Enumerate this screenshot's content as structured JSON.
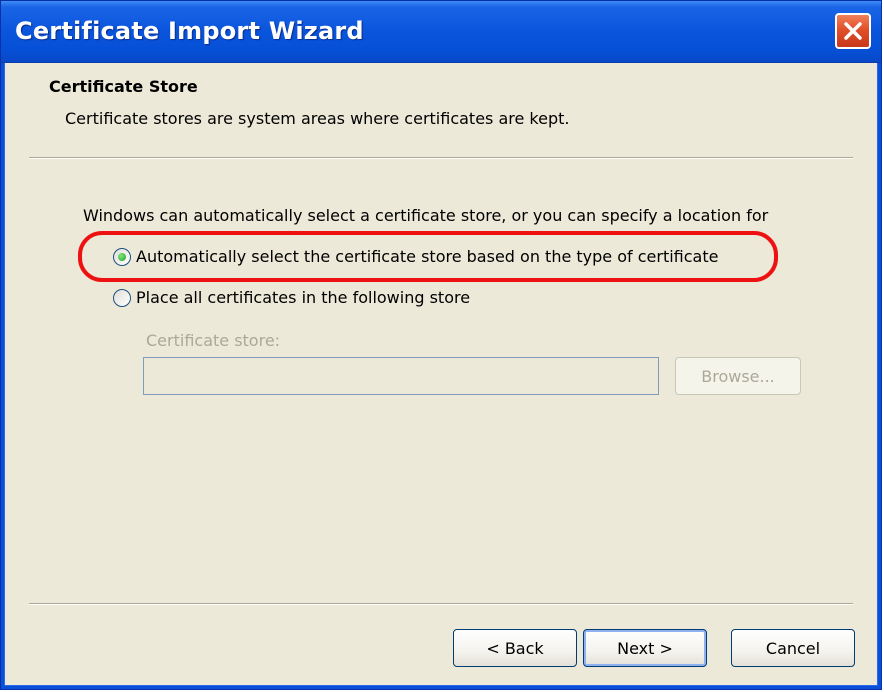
{
  "window": {
    "title": "Certificate Import Wizard",
    "close_icon": "close-icon"
  },
  "header": {
    "title": "Certificate Store",
    "subtitle": "Certificate stores are system areas where certificates are kept."
  },
  "body": {
    "intro": "Windows can automatically select a certificate store, or you can specify a location for",
    "options": [
      {
        "label": "Automatically select the certificate store based on the type of certificate",
        "checked": true
      },
      {
        "label": "Place all certificates in the following store",
        "checked": false
      }
    ],
    "store_label": "Certificate store:",
    "store_value": "",
    "browse_label": "Browse..."
  },
  "footer": {
    "back_label": "< Back",
    "next_label": "Next >",
    "cancel_label": "Cancel"
  },
  "colors": {
    "highlight": "#ee1111",
    "titlebar": "#0a55dc"
  }
}
